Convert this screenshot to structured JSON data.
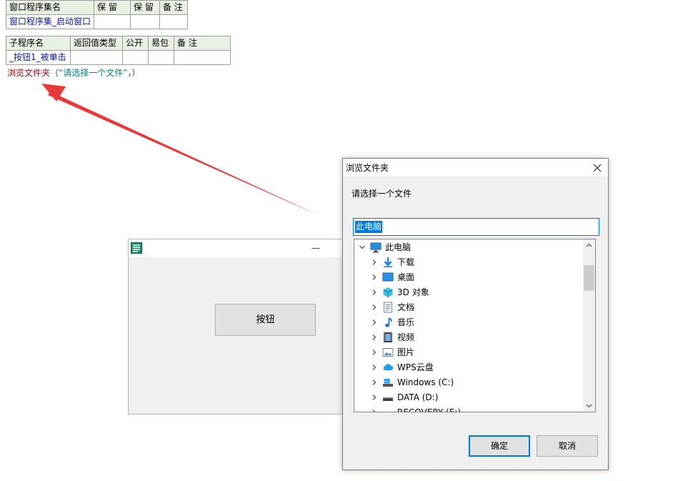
{
  "code_table_1": {
    "headers": [
      "窗口程序集名",
      "保 留",
      "保 留",
      "备 注"
    ],
    "row": [
      "窗口程序集_启动窗口",
      "",
      "",
      ""
    ]
  },
  "code_table_2": {
    "headers": [
      "子程序名",
      "返回值类型",
      "公开",
      "易包",
      "备 注"
    ],
    "row": [
      "_按钮1_被单击",
      "",
      "",
      "",
      ""
    ]
  },
  "code_line": {
    "func": "浏览文件夹",
    "open": "（",
    "arg": "“请选择一个文件”",
    "comma": "，",
    "close": "）"
  },
  "app_window": {
    "minimize_glyph": "—",
    "button_label": "按钮"
  },
  "dialog": {
    "title": "浏览文件夹",
    "prompt": "请选择一个文件",
    "input_value": "此电脑",
    "tree": [
      {
        "label": "此电脑",
        "icon": "computer-icon",
        "expanded": true
      },
      {
        "label": "下载",
        "icon": "download-icon"
      },
      {
        "label": "桌面",
        "icon": "desktop-icon"
      },
      {
        "label": "3D 对象",
        "icon": "3d-objects-icon"
      },
      {
        "label": "文档",
        "icon": "document-icon"
      },
      {
        "label": "音乐",
        "icon": "music-icon"
      },
      {
        "label": "视频",
        "icon": "video-icon"
      },
      {
        "label": "图片",
        "icon": "picture-icon"
      },
      {
        "label": "WPS云盘",
        "icon": "cloud-icon"
      },
      {
        "label": "Windows (C:)",
        "icon": "windows-drive-icon"
      },
      {
        "label": "DATA (D:)",
        "icon": "drive-icon"
      },
      {
        "label": "RECOVERY (E:)",
        "icon": "drive-icon"
      }
    ],
    "ok_label": "确定",
    "cancel_label": "取消"
  },
  "colors": {
    "accent": "#0078d7",
    "arrow": "#e8393a",
    "header_bg": "#e8f0e4"
  }
}
